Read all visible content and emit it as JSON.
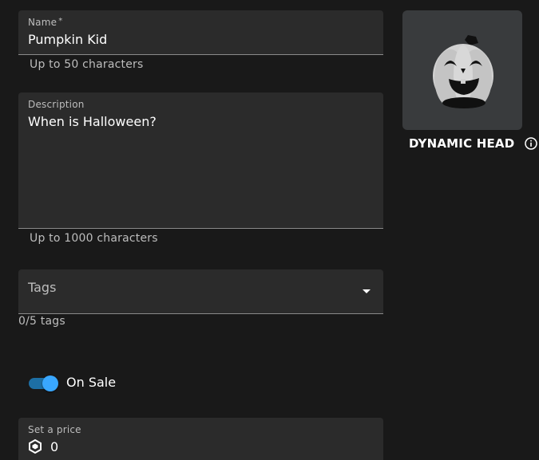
{
  "name_field": {
    "label": "Name",
    "required_mark": "*",
    "value": "Pumpkin Kid",
    "helper": "Up to 50 characters"
  },
  "description_field": {
    "label": "Description",
    "value": "When is Halloween?",
    "helper": "Up to 1000 characters"
  },
  "tags_field": {
    "placeholder": "Tags",
    "helper": "0/5 tags",
    "icon": "chevron-down-icon"
  },
  "sale_toggle": {
    "label": "On Sale",
    "enabled": true,
    "accent_color": "#39a7ff"
  },
  "price_field": {
    "label": "Set a price",
    "value": "0",
    "icon": "robux-icon"
  },
  "asset": {
    "type_label": "DYNAMIC HEAD",
    "info_icon": "info-icon",
    "thumbnail": "pumpkin-head-thumbnail"
  }
}
